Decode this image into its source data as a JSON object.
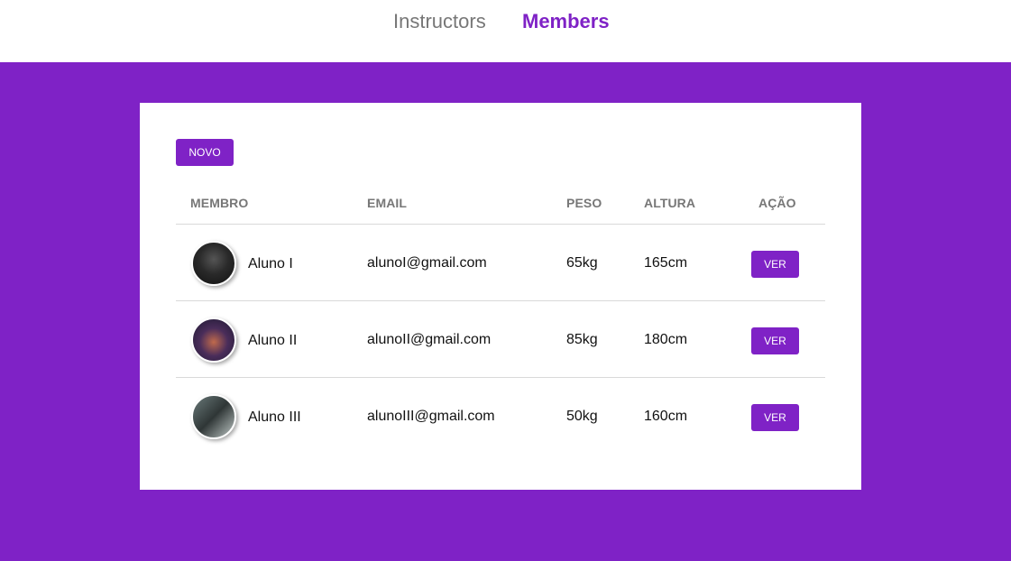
{
  "nav": {
    "instructors": "Instructors",
    "members": "Members",
    "active": "members"
  },
  "actions": {
    "new_label": "NOVO"
  },
  "table": {
    "headers": {
      "member": "MEMBRO",
      "email": "EMAIL",
      "weight": "PESO",
      "height": "ALTURA",
      "action": "AÇÃO"
    },
    "rows": [
      {
        "avatar": "member-photo",
        "name": "Aluno I",
        "email": "alunoI@gmail.com",
        "weight": "65kg",
        "height": "165cm",
        "action": "VER"
      },
      {
        "avatar": "member-photo",
        "name": "Aluno II",
        "email": "alunoII@gmail.com",
        "weight": "85kg",
        "height": "180cm",
        "action": "VER"
      },
      {
        "avatar": "member-photo",
        "name": "Aluno III",
        "email": "alunoIII@gmail.com",
        "weight": "50kg",
        "height": "160cm",
        "action": "VER"
      }
    ]
  },
  "colors": {
    "brand": "#7f22c6",
    "nav_inactive": "#777777",
    "card_bg": "#ffffff"
  }
}
